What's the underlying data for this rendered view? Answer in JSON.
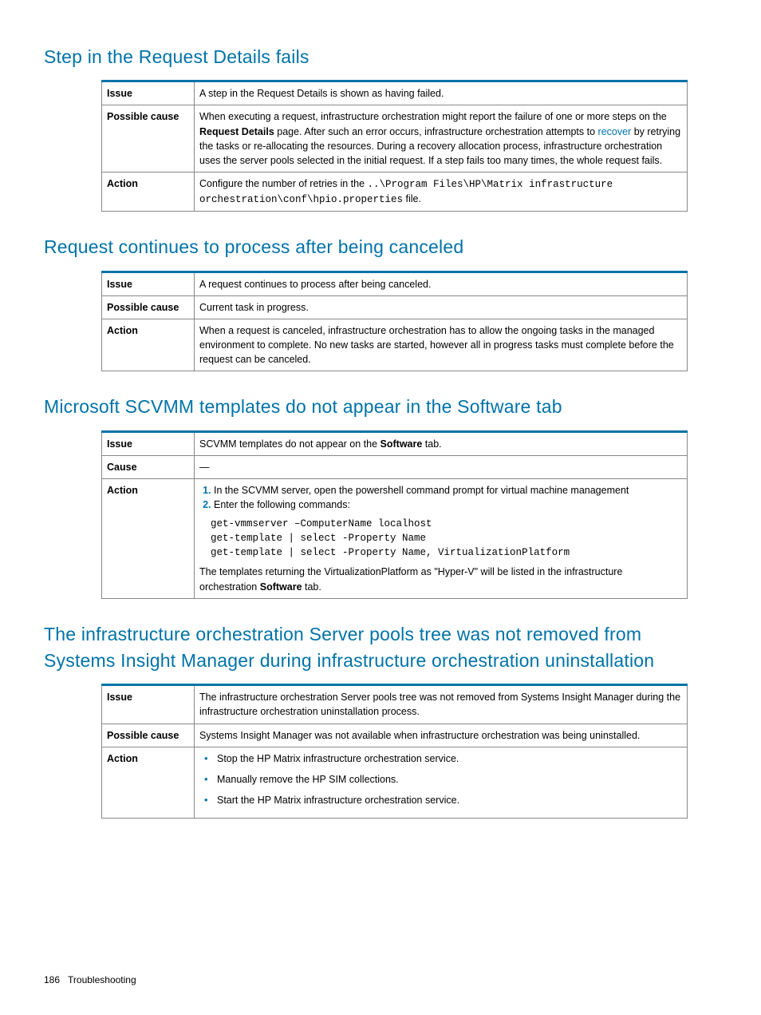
{
  "sections": {
    "s1": {
      "heading": "Step in the Request Details fails",
      "rows": {
        "issue_label": "Issue",
        "issue_text": "A step in the Request Details is shown as having failed.",
        "cause_label": "Possible cause",
        "cause_pre": "When executing a request, infrastructure orchestration might report the failure of one or more steps on the ",
        "cause_bold": "Request Details",
        "cause_mid": " page. After such an error occurs, infrastructure orchestration attempts to ",
        "cause_link": "recover",
        "cause_post": " by retrying the tasks or re-allocating the resources. During a recovery allocation process, infrastructure orchestration uses the server pools selected in the initial request. If a step fails too many times, the whole request fails.",
        "action_label": "Action",
        "action_pre": "Configure the number of retries in the ",
        "action_code": "..\\Program Files\\HP\\Matrix infrastructure orchestration\\conf\\hpio.properties",
        "action_post": " file."
      }
    },
    "s2": {
      "heading": "Request continues to process after being canceled",
      "rows": {
        "issue_label": "Issue",
        "issue_text": "A request continues to process after being canceled.",
        "cause_label": "Possible cause",
        "cause_text": "Current task in progress.",
        "action_label": "Action",
        "action_text": "When a request is canceled, infrastructure orchestration has to allow the ongoing tasks in the managed environment to complete. No new tasks are started, however all in progress tasks must complete before the request can be canceled."
      }
    },
    "s3": {
      "heading": "Microsoft SCVMM templates do not appear in the Software tab",
      "rows": {
        "issue_label": "Issue",
        "issue_pre": "SCVMM templates do not appear on the ",
        "issue_bold": "Software",
        "issue_post": " tab.",
        "cause_label": "Cause",
        "cause_text": "—",
        "action_label": "Action",
        "step1": "In the SCVMM server, open the powershell command prompt for virtual machine management",
        "step2": "Enter the following commands:",
        "cmd1": "get-vmmserver –ComputerName localhost",
        "cmd2": "get-template | select -Property Name",
        "cmd3": "get-template | select -Property Name, VirtualizationPlatform",
        "note_pre": "The templates returning the VirtualizationPlatform as \"Hyper-V\" will be listed in the infrastructure orchestration ",
        "note_bold": "Software",
        "note_post": " tab."
      }
    },
    "s4": {
      "heading": "The infrastructure orchestration Server pools tree was not removed from Systems Insight Manager during infrastructure orchestration uninstallation",
      "rows": {
        "issue_label": "Issue",
        "issue_text": "The infrastructure orchestration Server pools tree was not removed from Systems Insight Manager during the infrastructure orchestration uninstallation process.",
        "cause_label": "Possible cause",
        "cause_text": "Systems Insight Manager was not available when infrastructure orchestration was being uninstalled.",
        "action_label": "Action",
        "b1": "Stop the HP Matrix infrastructure orchestration service.",
        "b2": "Manually remove the HP SIM collections.",
        "b3": "Start the HP Matrix infrastructure orchestration service."
      }
    }
  },
  "footer": {
    "page": "186",
    "title": "Troubleshooting"
  }
}
